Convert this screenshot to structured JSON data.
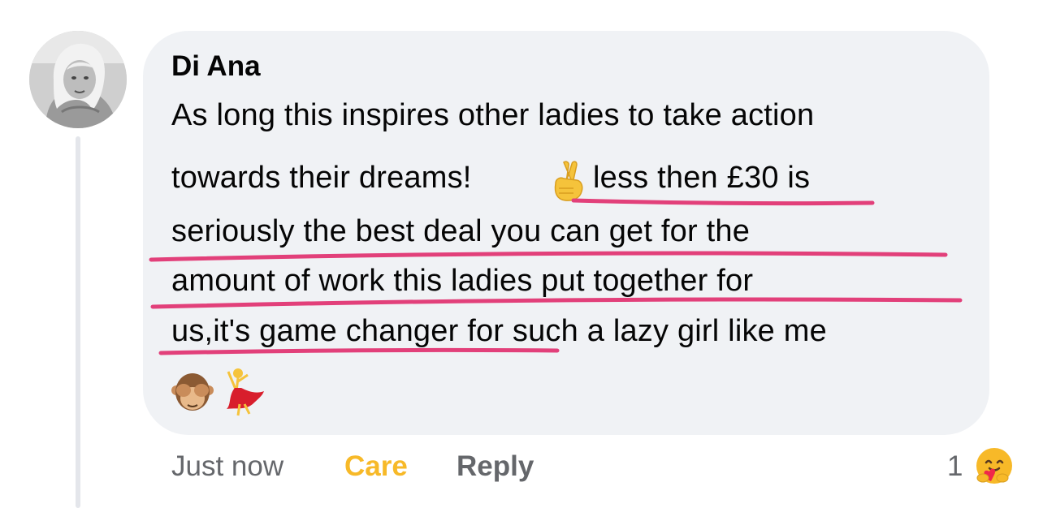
{
  "comment": {
    "author": "Di Ana",
    "lines": [
      "As long this inspires other ladies to take action",
      "towards their dreams!",
      "less then £30 is",
      "seriously the best deal you can get for the",
      "amount of work this ladies put together for",
      "us,it's game changer for such a lazy girl like me"
    ],
    "emojis": [
      "crossed-fingers",
      "see-no-evil-monkey",
      "dancing-woman"
    ]
  },
  "actions": {
    "timestamp": "Just now",
    "reaction_label": "Care",
    "reply_label": "Reply",
    "reaction_count": "1",
    "reaction_icon": "care-hug-emoji"
  },
  "colors": {
    "bubble": "#f0f2f5",
    "text": "#050505",
    "meta": "#65676b",
    "care": "#f7b928",
    "underline": "#e2407a"
  }
}
